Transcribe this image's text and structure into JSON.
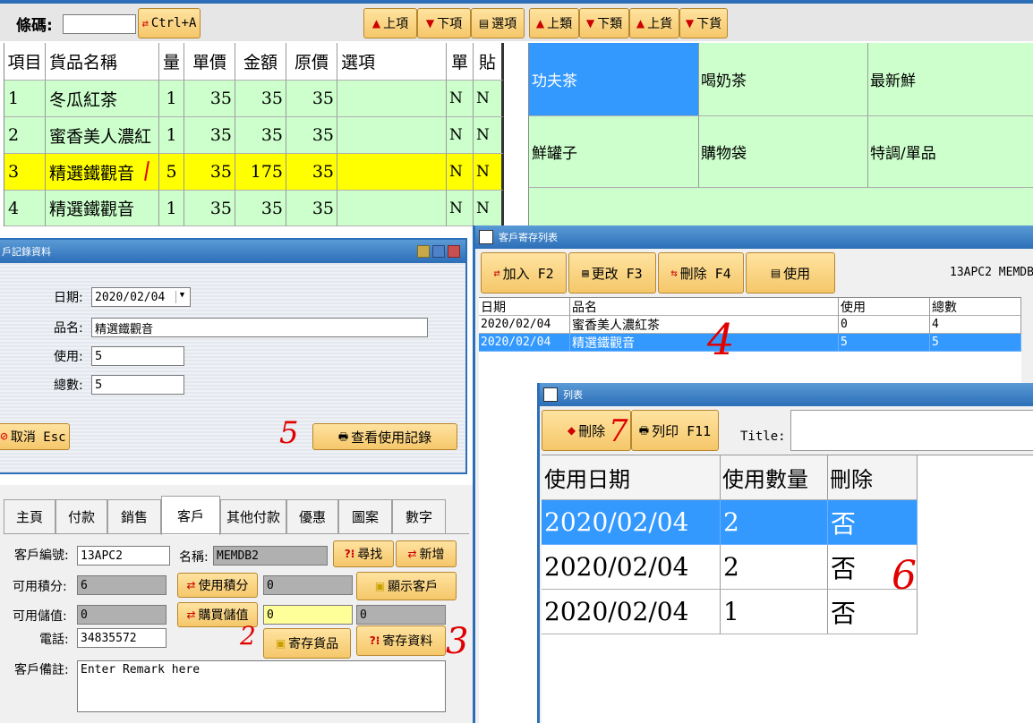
{
  "top_bar": {
    "barcode_label": "條碼:",
    "barcode_value": "",
    "ctrl_a_label": "Ctrl+A",
    "prev_item_label": "上項",
    "next_item_label": "下項",
    "options_label": "選項",
    "prev_category_label": "上類",
    "next_category_label": "下類",
    "prev_goods_label": "上貨",
    "next_goods_label": "下貨"
  },
  "order_table": {
    "headers": [
      "項目",
      "貨品名稱",
      "量",
      "單價",
      "金額",
      "原價",
      "選項",
      "單",
      "貼"
    ],
    "rows": [
      {
        "no": "1",
        "name": "冬瓜紅茶",
        "qty": "1",
        "price": "35",
        "amount": "35",
        "orig": "35",
        "option": "",
        "dan": "N",
        "tie": "N"
      },
      {
        "no": "2",
        "name": "蜜香美人濃紅",
        "qty": "1",
        "price": "35",
        "amount": "35",
        "orig": "35",
        "option": "",
        "dan": "N",
        "tie": "N"
      },
      {
        "no": "3",
        "name": "精選鐵觀音",
        "qty": "5",
        "price": "35",
        "amount": "175",
        "orig": "35",
        "option": "",
        "dan": "N",
        "tie": "N"
      },
      {
        "no": "4",
        "name": "精選鐵觀音",
        "qty": "1",
        "price": "35",
        "amount": "35",
        "orig": "35",
        "option": "",
        "dan": "N",
        "tie": "N"
      }
    ],
    "selected_row_color": "#ffff00",
    "row_color": "#ccffcc"
  },
  "category_grid": {
    "items": [
      "功夫茶",
      "喝奶茶",
      "最新鮮",
      "鮮罐子",
      "購物袋",
      "特調/單品"
    ],
    "selected_color": "#3399ff",
    "cell_color": "#ccffcc"
  },
  "record_dialog": {
    "title": "戶記錄資料",
    "date_label": "日期:",
    "date_value": "2020/02/04",
    "product_label": "品名:",
    "product_value": "精選鐵觀音",
    "use_label": "使用:",
    "use_value": "5",
    "total_label": "總數:",
    "total_value": "5",
    "cancel_label": "取消 Esc",
    "view_usage_label": "查看使用記錄"
  },
  "customer_panel": {
    "tabs": [
      "主頁",
      "付款",
      "銷售",
      "客戶",
      "其他付款",
      "優惠",
      "圖案",
      "數字"
    ],
    "active_tab": "客戶",
    "customer_no_label": "客戶編號:",
    "customer_no_value": "13APC2",
    "name_label": "名稱:",
    "name_value": "MEMDB2",
    "find_label": "尋找",
    "add_label": "新增",
    "points_label": "可用積分:",
    "points_value": "6",
    "use_points_label": "使用積分",
    "use_points_value": "0",
    "show_customer_label": "顯示客戶",
    "stored_label": "可用儲值:",
    "stored_value": "0",
    "buy_stored_label": "購買儲值",
    "buy_stored_value": "0",
    "stored_extra_value": "0",
    "phone_label": "電話:",
    "phone_value": "34835572",
    "deposit_goods_label": "寄存貨品",
    "deposit_data_label": "寄存資料",
    "remark_label": "客戶備註:",
    "remark_value": "Enter Remark here"
  },
  "deposit_list": {
    "title": "客戶寄存列表",
    "add_label": "加入 F2",
    "edit_label": "更改 F3",
    "delete_label": "刪除 F4",
    "use_label": "使用",
    "customer_info": "13APC2 MEMDB",
    "headers": [
      "日期",
      "品名",
      "使用",
      "總數"
    ],
    "rows": [
      {
        "date": "2020/02/04",
        "name": "蜜香美人濃紅茶",
        "used": "0",
        "total": "4"
      },
      {
        "date": "2020/02/04",
        "name": "精選鐵觀音",
        "used": "5",
        "total": "5"
      }
    ]
  },
  "usage_list": {
    "title": "列表",
    "delete_label": "刪除",
    "print_label": "列印 F11",
    "title_label": "Title:",
    "headers": [
      "使用日期",
      "使用數量",
      "刪除"
    ],
    "rows": [
      {
        "date": "2020/02/04",
        "qty": "2",
        "deleted": "否"
      },
      {
        "date": "2020/02/04",
        "qty": "2",
        "deleted": "否"
      },
      {
        "date": "2020/02/04",
        "qty": "1",
        "deleted": "否"
      }
    ]
  },
  "annotations": {
    "mark_2": "2",
    "mark_3": "3",
    "mark_4": "4",
    "mark_5": "5",
    "mark_6": "6",
    "mark_7": "7",
    "ink_color": "#e00000"
  }
}
